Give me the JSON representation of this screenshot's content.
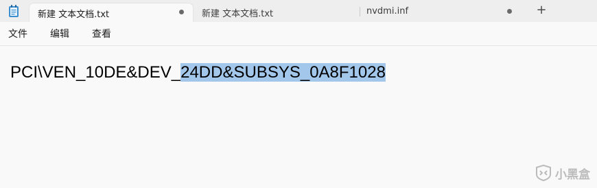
{
  "tabs": [
    {
      "label": "新建 文本文档.txt",
      "active": true,
      "unsaved": true
    },
    {
      "label": "新建 文本文档.txt",
      "active": false,
      "unsaved": false
    },
    {
      "label": "nvdmi.inf",
      "active": false,
      "unsaved": true
    }
  ],
  "new_tab_label": "+",
  "menu": {
    "file": "文件",
    "edit": "编辑",
    "view": "查看"
  },
  "editor": {
    "text_before_selection": "PCI\\VEN_10DE&DEV_",
    "selected_text": "24DD&SUBSYS_0A8F1028"
  },
  "watermark": {
    "text": "小黑盒"
  },
  "colors": {
    "selection": "#a3c7ea",
    "tabbar_bg": "#eeeeee",
    "editor_bg": "#f9f9f9"
  }
}
